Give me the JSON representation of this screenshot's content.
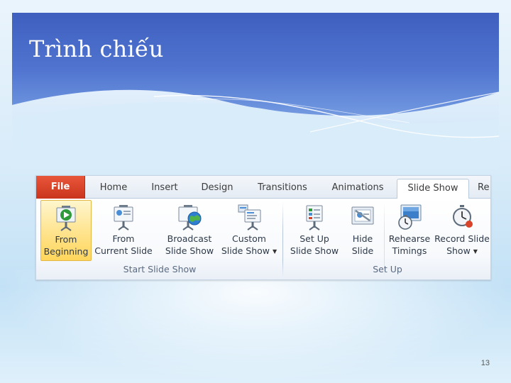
{
  "slide": {
    "title": "Trình chiếu",
    "page_number": "13"
  },
  "ribbon": {
    "tabs": [
      {
        "label": "File"
      },
      {
        "label": "Home"
      },
      {
        "label": "Insert"
      },
      {
        "label": "Design"
      },
      {
        "label": "Transitions"
      },
      {
        "label": "Animations"
      },
      {
        "label": "Slide Show",
        "active": true
      },
      {
        "label": "Re"
      }
    ],
    "groups": {
      "start_slide_show": {
        "label": "Start Slide Show",
        "buttons": [
          {
            "line1": "From",
            "line2": "Beginning",
            "icon": "play-from-beginning-icon",
            "selected": true
          },
          {
            "line1": "From",
            "line2": "Current Slide",
            "icon": "projector-screen-icon"
          },
          {
            "line1": "Broadcast",
            "line2": "Slide Show",
            "icon": "broadcast-globe-icon"
          },
          {
            "line1": "Custom",
            "line2": "Slide Show",
            "icon": "custom-slide-show-icon",
            "dropdown": true
          }
        ]
      },
      "set_up": {
        "label": "Set Up",
        "buttons": [
          {
            "line1": "Set Up",
            "line2": "Slide Show",
            "icon": "setup-slide-show-icon"
          },
          {
            "line1": "Hide",
            "line2": "Slide",
            "icon": "hide-slide-icon"
          },
          {
            "line1": "Rehearse",
            "line2": "Timings",
            "icon": "rehearse-timings-icon"
          },
          {
            "line1": "Record Slide",
            "line2": "Show",
            "icon": "record-stopwatch-icon",
            "dropdown": true
          }
        ]
      }
    },
    "colors": {
      "file_tab": "#d9432a",
      "selected_button": "#ffe38c",
      "header_blue": "#4f73cf"
    }
  }
}
